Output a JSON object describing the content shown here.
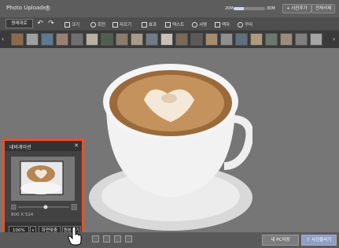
{
  "header": {
    "title": "Photo Uploader",
    "help_icon": "question-icon",
    "usage_label": "20M",
    "usage_total": "30M",
    "usage_fraction": 0.33,
    "add_photo_label": "+ 사진추가",
    "delete_all_label": "전체삭제"
  },
  "toolbar": {
    "list_label": "원래대로",
    "tools": [
      {
        "label": "크기",
        "icon": "resize-icon"
      },
      {
        "label": "회전",
        "icon": "rotate-icon"
      },
      {
        "label": "자르기",
        "icon": "crop-icon"
      },
      {
        "label": "효과",
        "icon": "effect-icon"
      },
      {
        "label": "텍스트",
        "icon": "text-icon"
      },
      {
        "label": "서명",
        "icon": "signature-icon"
      },
      {
        "label": "액자",
        "icon": "frame-icon"
      },
      {
        "label": "꾸미",
        "icon": "decorate-icon"
      }
    ]
  },
  "navigation": {
    "title": "네비게이션",
    "image_size": "800 X 514",
    "zoom_value": "100%",
    "fit_label": "화면맞춤",
    "original_label": "원본보기"
  },
  "bottom": {
    "save_pc_label": "내 PC저장",
    "upload_label": "↑ 사진올리기"
  }
}
